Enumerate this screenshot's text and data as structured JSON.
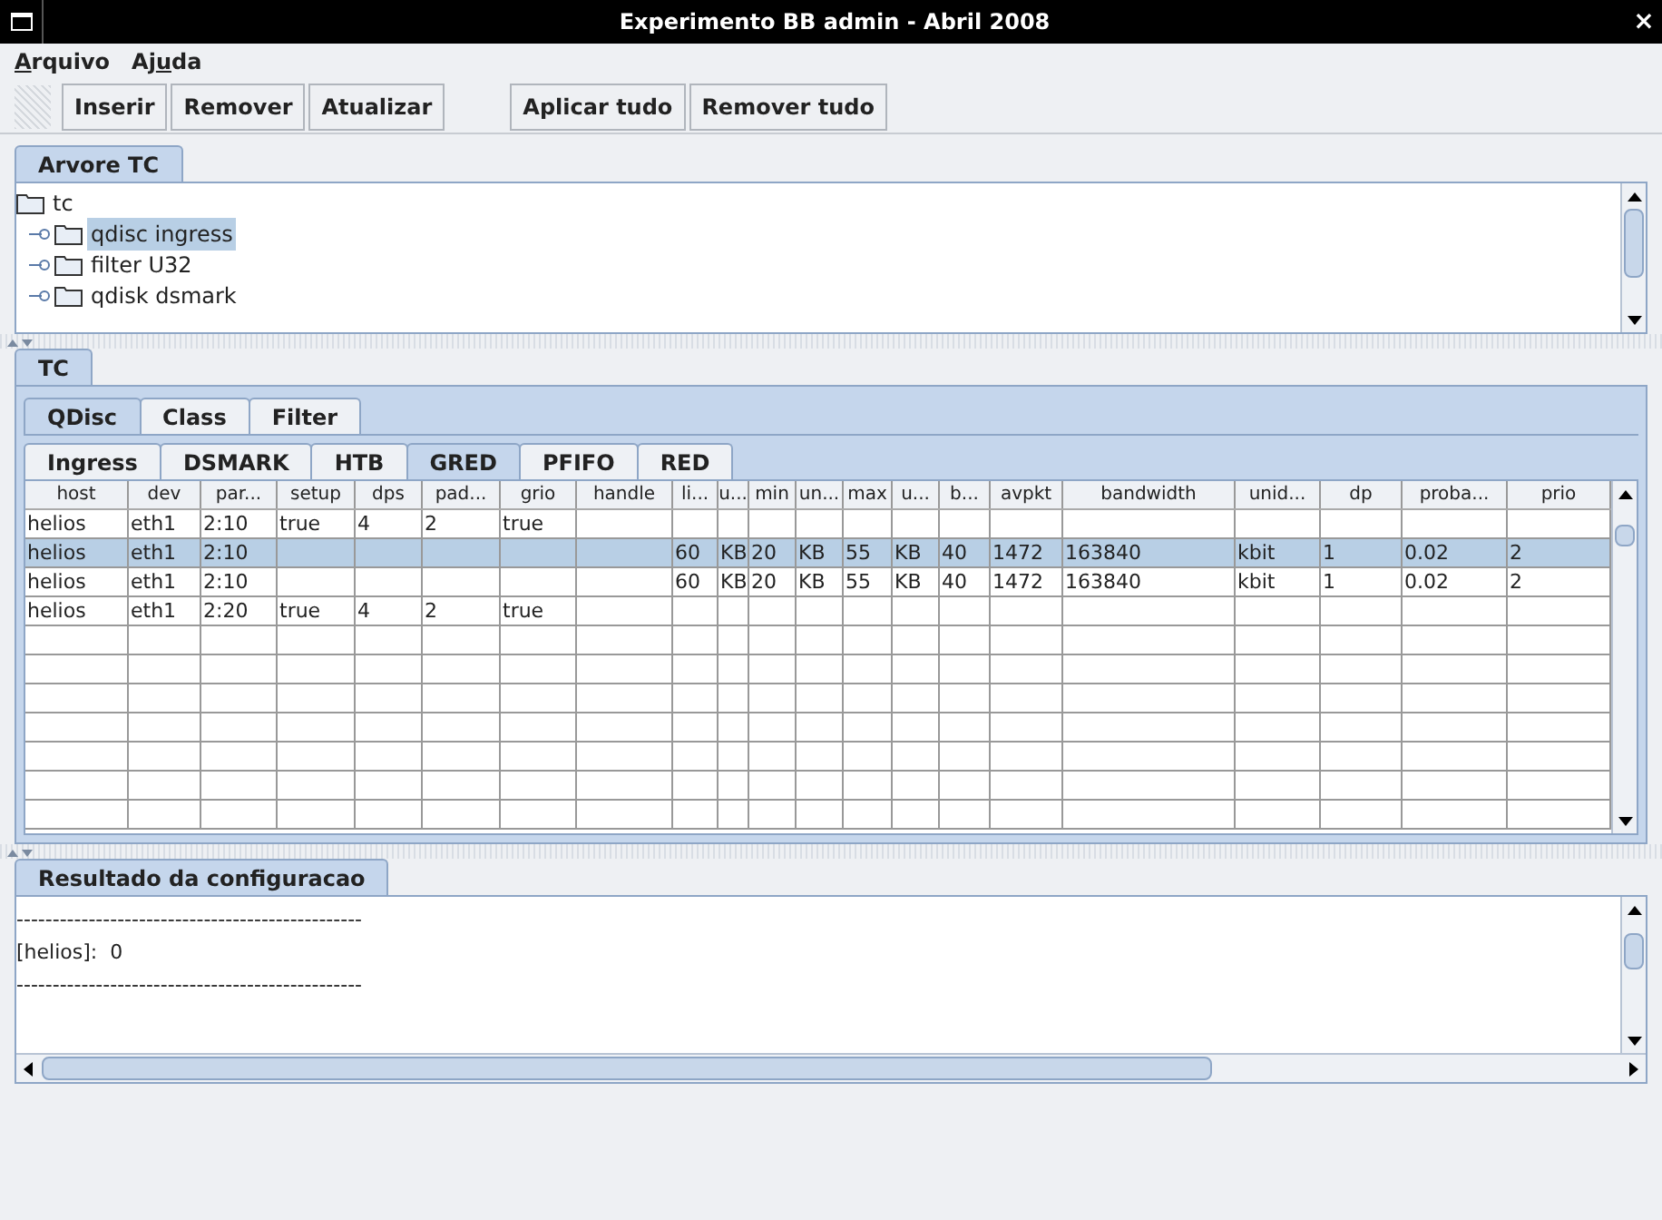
{
  "window": {
    "title": "Experimento BB admin - Abril 2008",
    "close": "×"
  },
  "menu": [
    {
      "label": "Arquivo"
    },
    {
      "label": "Ajuda"
    }
  ],
  "toolbar": {
    "groups": [
      [
        "Inserir",
        "Remover",
        "Atualizar"
      ],
      [
        "Aplicar tudo",
        "Remover tudo"
      ]
    ]
  },
  "tree_panel": {
    "tab": "Arvore TC",
    "items": [
      {
        "label": "tc",
        "selected": false,
        "children": [
          {
            "label": "qdisc ingress",
            "selected": true
          },
          {
            "label": "filter U32",
            "selected": false
          },
          {
            "label": "qdisk dsmark",
            "selected": false
          }
        ]
      }
    ]
  },
  "tc_panel": {
    "tab": "TC",
    "tabs": [
      {
        "label": "QDisc",
        "selected": true
      },
      {
        "label": "Class",
        "selected": false
      },
      {
        "label": "Filter",
        "selected": false
      }
    ],
    "subtabs": [
      {
        "label": "Ingress",
        "selected": false
      },
      {
        "label": "DSMARK",
        "selected": false
      },
      {
        "label": "HTB",
        "selected": false
      },
      {
        "label": "GRED",
        "selected": true
      },
      {
        "label": "PFIFO",
        "selected": false
      },
      {
        "label": "RED",
        "selected": false
      }
    ],
    "columns": [
      "host",
      "dev",
      "par...",
      "setup",
      "dps",
      "pad...",
      "grio",
      "handle",
      "li...",
      "u...",
      "min",
      "un...",
      "max",
      "u...",
      "b...",
      "avpkt",
      "bandwidth",
      "unid...",
      "dp",
      "proba...",
      "prio"
    ],
    "rows": [
      {
        "selected": false,
        "cells": [
          "helios",
          "eth1",
          "2:10",
          "true",
          "4",
          "2",
          "true",
          "",
          "",
          "",
          "",
          "",
          "",
          "",
          "",
          "",
          "",
          "",
          "",
          "",
          ""
        ]
      },
      {
        "selected": true,
        "cells": [
          "helios",
          "eth1",
          "2:10",
          "",
          "",
          "",
          "",
          "",
          "60",
          "KB",
          "20",
          "KB",
          "55",
          "KB",
          "40",
          "1472",
          "163840",
          "kbit",
          "1",
          "0.02",
          "2"
        ]
      },
      {
        "selected": false,
        "cells": [
          "helios",
          "eth1",
          "2:10",
          "",
          "",
          "",
          "",
          "",
          "60",
          "KB",
          "20",
          "KB",
          "55",
          "KB",
          "40",
          "1472",
          "163840",
          "kbit",
          "1",
          "0.02",
          "2"
        ]
      },
      {
        "selected": false,
        "cells": [
          "helios",
          "eth1",
          "2:20",
          "true",
          "4",
          "2",
          "true",
          "",
          "",
          "",
          "",
          "",
          "",
          "",
          "",
          "",
          "",
          "",
          "",
          "",
          ""
        ]
      }
    ]
  },
  "result_panel": {
    "tab": "Resultado da configuracao",
    "lines": [
      "------------------------------------------------",
      "[helios]:  0",
      "------------------------------------------------"
    ]
  }
}
